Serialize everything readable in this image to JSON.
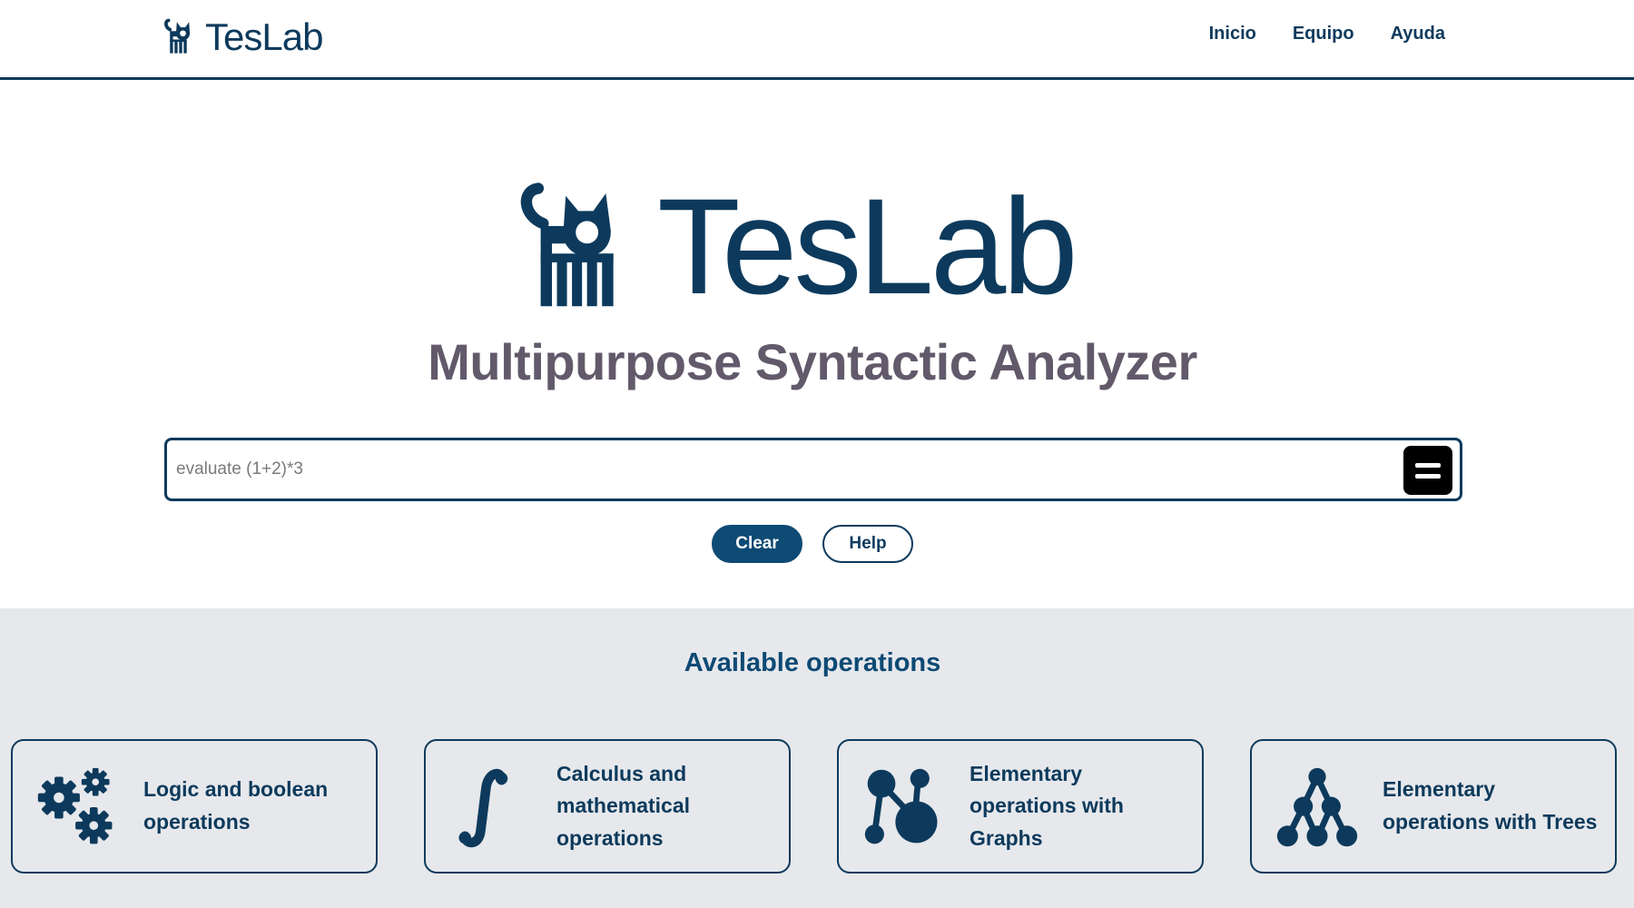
{
  "header": {
    "brand": "TesLab",
    "nav": [
      "Inicio",
      "Equipo",
      "Ayuda"
    ]
  },
  "hero": {
    "logo_text": "TesLab",
    "subtitle": "Multipurpose Syntactic Analyzer"
  },
  "search": {
    "placeholder": "evaluate (1+2)*3",
    "value": ""
  },
  "actions": {
    "clear_label": "Clear",
    "help_label": "Help"
  },
  "operations": {
    "title": "Available operations",
    "cards": [
      {
        "label": "Logic and boolean operations",
        "icon": "gears-icon"
      },
      {
        "label": "Calculus and mathematical operations",
        "icon": "integral-icon"
      },
      {
        "label": "Elementary operations with Graphs",
        "icon": "graph-nodes-icon"
      },
      {
        "label": "Elementary operations with Trees",
        "icon": "tree-icon"
      }
    ]
  },
  "colors": {
    "primary": "#0d3a5c",
    "subtitle": "#625a6b",
    "section_bg": "#e6e8ec"
  }
}
